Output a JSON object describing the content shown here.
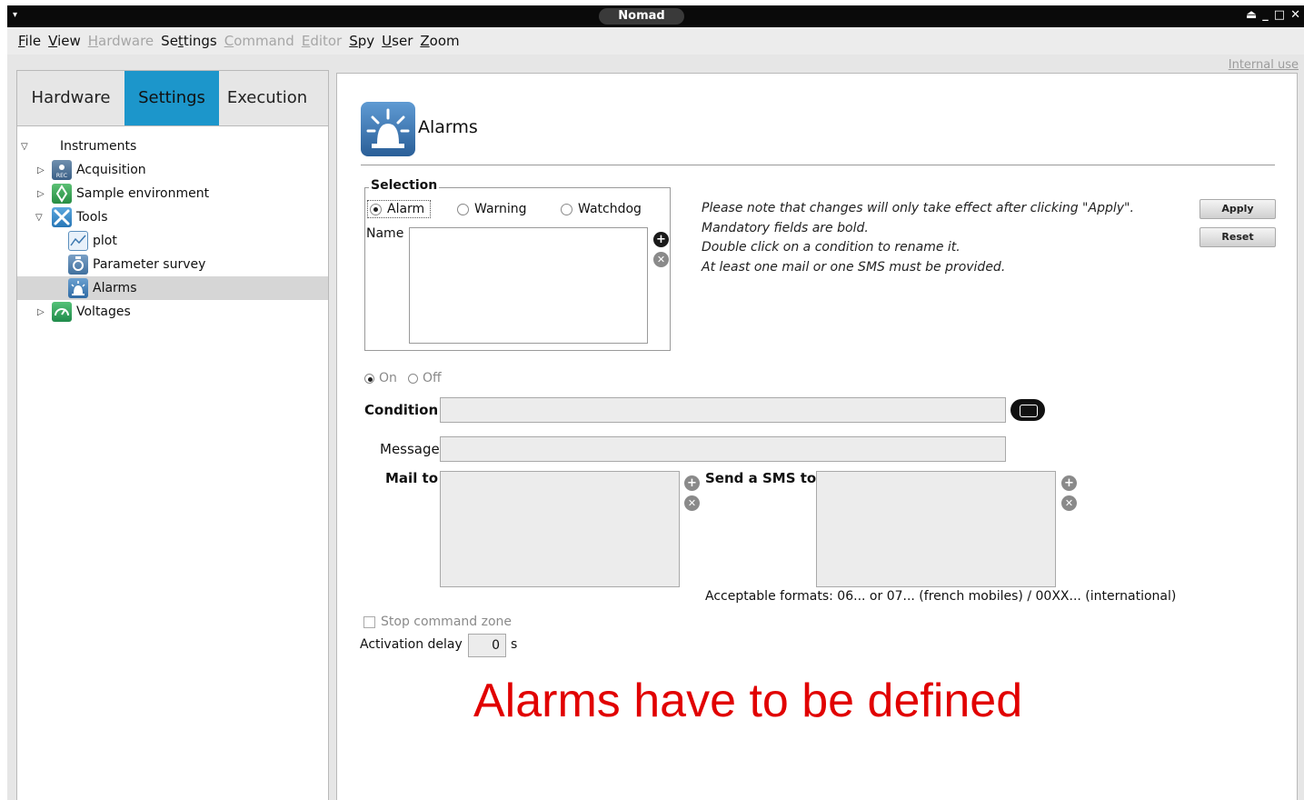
{
  "window": {
    "title": "Nomad",
    "wm_menu_icon": "▾",
    "wm_controls": [
      "⏏",
      "_",
      "□",
      "✕"
    ]
  },
  "menubar": {
    "items": [
      {
        "label": "File",
        "ul": "F",
        "rest": "ile",
        "disabled": false
      },
      {
        "label": "View",
        "ul": "V",
        "rest": "iew",
        "disabled": false
      },
      {
        "label": "Hardware",
        "ul": "H",
        "rest": "ardware",
        "disabled": true
      },
      {
        "label": "Settings",
        "pre": "Se",
        "ul": "t",
        "rest": "tings",
        "disabled": false
      },
      {
        "label": "Command",
        "ul": "C",
        "rest": "ommand",
        "disabled": true
      },
      {
        "label": "Editor",
        "ul": "E",
        "rest": "ditor",
        "disabled": true
      },
      {
        "label": "Spy",
        "ul": "S",
        "rest": "py",
        "disabled": false
      },
      {
        "label": "User",
        "ul": "U",
        "rest": "ser",
        "disabled": false
      },
      {
        "label": "Zoom",
        "ul": "Z",
        "rest": "oom",
        "disabled": false
      }
    ]
  },
  "left_tabs": {
    "hardware": "Hardware",
    "settings": "Settings",
    "execution": "Execution",
    "active": "Settings"
  },
  "tree": {
    "root": "Instruments",
    "acquisition": "Acquisition",
    "sample_env": "Sample environment",
    "tools": "Tools",
    "plot": "plot",
    "param_survey": "Parameter survey",
    "alarms": "Alarms",
    "voltages": "Voltages",
    "rec_badge": "REC"
  },
  "internal_use": "Internal use",
  "panel": {
    "title": "Alarms",
    "selection_legend": "Selection",
    "radio_alarm": "Alarm",
    "radio_warning": "Warning",
    "radio_watchdog": "Watchdog",
    "selected_type": "Alarm",
    "name_label": "Name",
    "notes": [
      "Please note that changes will only take effect after clicking \"Apply\".",
      "Mandatory fields are bold.",
      "Double click on a condition to rename it.",
      "At least one mail or one SMS must be provided."
    ],
    "apply": "Apply",
    "reset": "Reset",
    "on_label": "On",
    "off_label": "Off",
    "state": "On",
    "condition_label": "Condition",
    "condition_value": "",
    "message_label": "Message",
    "message_value": "",
    "mail_label": "Mail to",
    "sms_label": "Send a SMS to",
    "formats_note": "Acceptable formats: 06... or 07... (french mobiles) / 00XX... (international)",
    "stop_zone_label": "Stop command zone",
    "stop_zone_checked": false,
    "delay_label": "Activation delay",
    "delay_value": "0",
    "delay_unit": "s"
  },
  "annotation": "Alarms have to be defined",
  "colors": {
    "active_tab": "#1c96cb",
    "annotation": "#e10000",
    "titlebar": "#0a0a0a"
  },
  "icons": {
    "tools": "wrench-screwdriver-icon",
    "alarm": "siren-icon",
    "add": "plus-circle-icon",
    "remove": "x-circle-icon",
    "condition_edit": "condition-editor-icon"
  }
}
